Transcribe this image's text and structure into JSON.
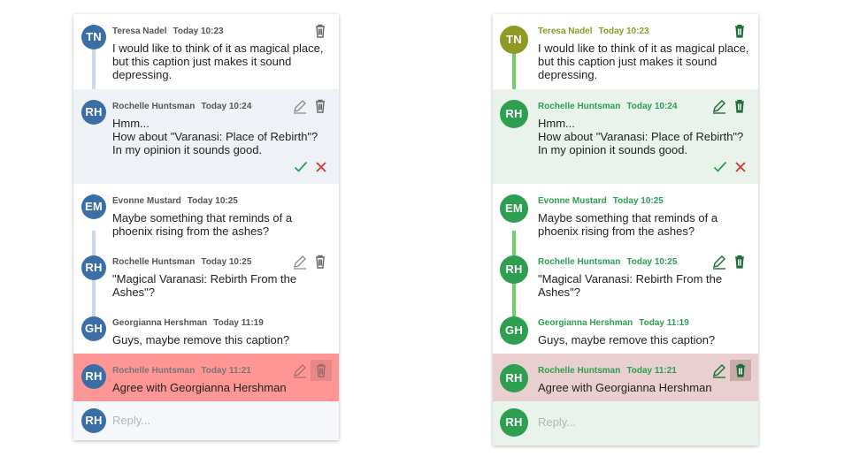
{
  "colors": {
    "left_accent": "#3a6ea5",
    "right_accent": "#2e9e50",
    "right_author_tn": "#8f9a24",
    "error_red": "#d9352c",
    "confirm_green": "#2e9e50"
  },
  "reply_placeholder": "Reply...",
  "threads": [
    {
      "panel": "left",
      "comments": [
        {
          "initials": "TN",
          "author": "Teresa Nadel",
          "time": "Today 10:23",
          "lines": [
            "I would like to think of it as magical place,",
            "but this caption just makes it sound",
            "depressing."
          ],
          "state": "normal",
          "editable": false
        },
        {
          "initials": "RH",
          "author": "Rochelle Huntsman",
          "time": "Today 10:24",
          "lines": [
            "Hmm...",
            "How about \"Varanasi: Place of Rebirth\"?",
            "In my opinion it sounds good."
          ],
          "state": "editing",
          "editable": true
        },
        {
          "initials": "EM",
          "author": "Evonne Mustard",
          "time": "Today 10:25",
          "lines": [
            "Maybe something that reminds of a",
            "phoenix rising from the ashes?"
          ],
          "state": "normal",
          "editable": false
        },
        {
          "initials": "RH",
          "author": "Rochelle Huntsman",
          "time": "Today 10:25",
          "lines": [
            "\"Magical Varanasi: Rebirth From the",
            "Ashes\"?"
          ],
          "state": "normal",
          "editable": true
        },
        {
          "initials": "GH",
          "author": "Georgianna Hershman",
          "time": "Today 11:19",
          "lines": [
            "Guys, maybe remove this caption?"
          ],
          "state": "normal",
          "editable": false
        },
        {
          "initials": "RH",
          "author": "Rochelle Huntsman",
          "time": "Today 11:21",
          "lines": [
            "Agree with Georgianna Hershman"
          ],
          "state": "delete-hover",
          "editable": true
        }
      ]
    },
    {
      "panel": "right",
      "comments": [
        {
          "initials": "TN",
          "author": "Teresa Nadel",
          "time": "Today 10:23",
          "lines": [
            "I would like to think of it as magical place,",
            "but this caption just makes it sound",
            "depressing."
          ],
          "state": "normal",
          "editable": false
        },
        {
          "initials": "RH",
          "author": "Rochelle Huntsman",
          "time": "Today 10:24",
          "lines": [
            "Hmm...",
            "How about \"Varanasi: Place of Rebirth\"?",
            "In my opinion it sounds good."
          ],
          "state": "editing",
          "editable": true
        },
        {
          "initials": "EM",
          "author": "Evonne Mustard",
          "time": "Today 10:25",
          "lines": [
            "Maybe something that reminds of a",
            "phoenix rising from the ashes?"
          ],
          "state": "normal",
          "editable": false
        },
        {
          "initials": "RH",
          "author": "Rochelle Huntsman",
          "time": "Today 10:25",
          "lines": [
            "\"Magical Varanasi: Rebirth From the",
            "Ashes\"?"
          ],
          "state": "normal",
          "editable": true
        },
        {
          "initials": "GH",
          "author": "Georgianna Hershman",
          "time": "Today 11:19",
          "lines": [
            "Guys, maybe remove this caption?"
          ],
          "state": "normal",
          "editable": false
        },
        {
          "initials": "RH",
          "author": "Rochelle Huntsman",
          "time": "Today 11:21",
          "lines": [
            "Agree with Georgianna Hershman"
          ],
          "state": "delete-hover",
          "editable": true
        }
      ],
      "reply_initials": "RH"
    }
  ],
  "left_reply_initials": "RH"
}
